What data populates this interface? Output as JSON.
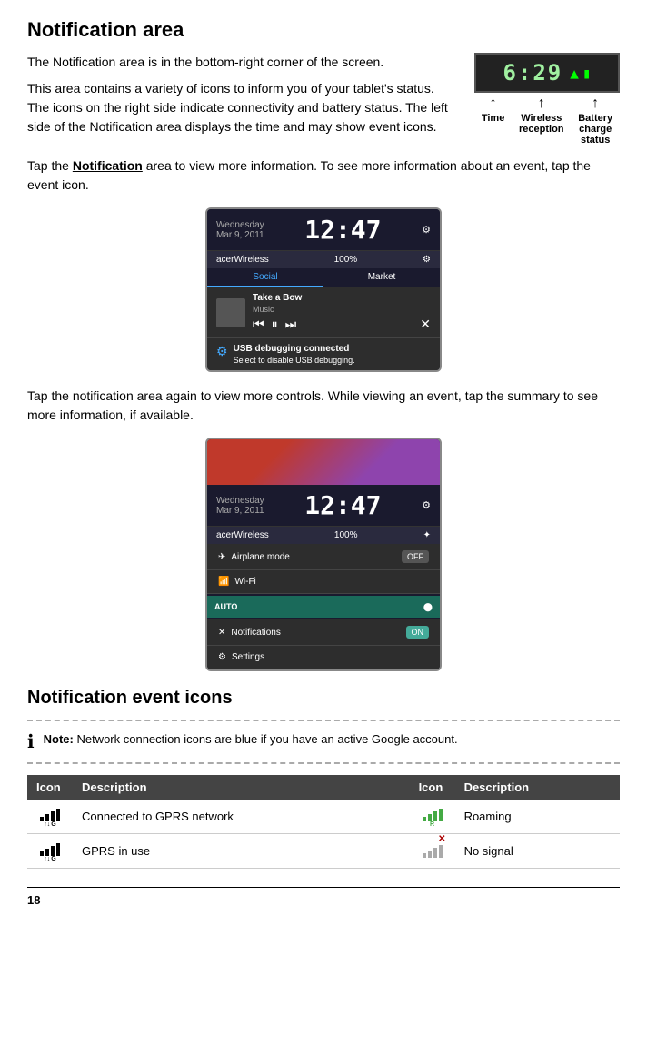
{
  "page": {
    "title": "Notification area",
    "intro_para1": "The Notification area is in the bottom-right corner of the screen.",
    "intro_para2": "This area contains a variety of icons to inform you of your tablet's status. The icons on the right side indicate connectivity and battery status. The left side of the Notification area displays the time and may show event icons.",
    "tap_info": "Tap the Notification area to view more information. To see more information about an event, tap the event icon.",
    "tap_again": "Tap the notification area again to view more controls. While viewing an event, tap the summary to see more information, if available.",
    "status_bar": {
      "time_label": "Time",
      "wireless_label": "Wireless reception",
      "battery_label": "Battery charge status",
      "display_time": "6:29"
    },
    "screenshot1": {
      "date": "Wednesday",
      "date2": "Mar 9, 2011",
      "clock": "12:47",
      "wifi_name": "acerWireless",
      "battery": "100%",
      "tab1": "Social",
      "tab2": "Market",
      "notification_title": "Take a Bow",
      "notification_sub": "Music",
      "usb_title": "USB debugging connected",
      "usb_sub": "Select to disable USB debugging."
    },
    "screenshot2": {
      "date": "Wednesday",
      "date2": "Mar 9, 2011",
      "clock": "12:47",
      "wifi_name": "acerWireless",
      "battery": "100%",
      "airplane_label": "Airplane mode",
      "airplane_toggle": "OFF",
      "wifi_label": "Wi-Fi",
      "auto_label": "AUTO",
      "notifications_label": "Notifications",
      "notifications_toggle": "ON",
      "settings_label": "Settings"
    },
    "notification_icons_title": "Notification event icons",
    "note_label": "Note:",
    "note_text": "Network connection icons are blue if you have an active Google account.",
    "table": {
      "col1_header": "Icon",
      "col2_header": "Description",
      "col3_header": "Icon",
      "col4_header": "Description",
      "rows": [
        {
          "icon1_type": "gprs_connected",
          "desc1": "Connected to GPRS network",
          "icon2_type": "roaming",
          "desc2": "Roaming"
        },
        {
          "icon1_type": "gprs_in_use",
          "desc1": "GPRS in use",
          "icon2_type": "no_signal",
          "desc2": "No signal"
        }
      ]
    },
    "page_number": "18"
  }
}
